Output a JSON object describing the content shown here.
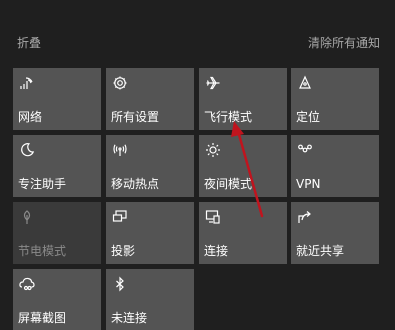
{
  "header": {
    "collapse_label": "折叠",
    "clear_all_label": "清除所有通知"
  },
  "tiles": [
    {
      "label": "网络",
      "icon": "network-icon",
      "state": "active"
    },
    {
      "label": "所有设置",
      "icon": "gear-icon",
      "state": "active"
    },
    {
      "label": "飞行模式",
      "icon": "airplane-icon",
      "state": "active"
    },
    {
      "label": "定位",
      "icon": "location-icon",
      "state": "active"
    },
    {
      "label": "专注助手",
      "icon": "moon-icon",
      "state": "active"
    },
    {
      "label": "移动热点",
      "icon": "hotspot-icon",
      "state": "active"
    },
    {
      "label": "夜间模式",
      "icon": "brightness-icon",
      "state": "active"
    },
    {
      "label": "VPN",
      "icon": "vpn-icon",
      "state": "active"
    },
    {
      "label": "节电模式",
      "icon": "battery-saver-icon",
      "state": "disabled"
    },
    {
      "label": "投影",
      "icon": "project-icon",
      "state": "active"
    },
    {
      "label": "连接",
      "icon": "connect-icon",
      "state": "active"
    },
    {
      "label": "就近共享",
      "icon": "nearby-share-icon",
      "state": "active"
    },
    {
      "label": "屏幕截图",
      "icon": "screenshot-icon",
      "state": "active"
    },
    {
      "label": "未连接",
      "icon": "bluetooth-icon",
      "state": "active"
    }
  ],
  "colors": {
    "background": "#1f1f1f",
    "tile": "#545454",
    "annotation_arrow": "#c0141e"
  }
}
